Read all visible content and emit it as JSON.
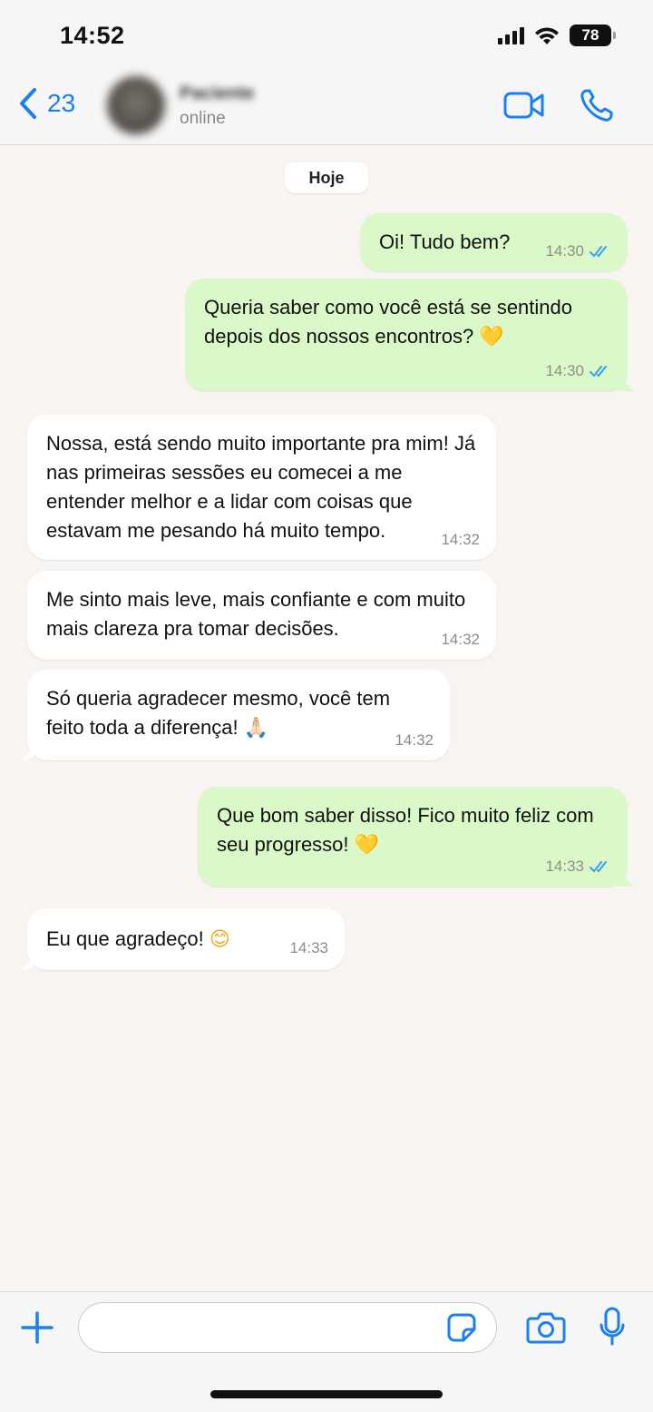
{
  "status_bar": {
    "time": "14:52",
    "battery": "78"
  },
  "header": {
    "back_count": "23",
    "contact_name": "Paciente",
    "contact_status": "online"
  },
  "chat": {
    "date_label": "Hoje",
    "messages": [
      {
        "dir": "out",
        "text": "Oi! Tudo bem?",
        "time": "14:30",
        "read": true
      },
      {
        "dir": "out",
        "text": "Queria saber como você está se sentindo depois dos nossos encontros?",
        "emoji": "💛",
        "time": "14:30",
        "read": true
      },
      {
        "dir": "in",
        "text": "Nossa, está sendo muito importante pra mim! Já nas primeiras sessões eu comecei a me entender melhor e a lidar com coisas que estavam me pesando há muito tempo.",
        "time": "14:32"
      },
      {
        "dir": "in",
        "text": "Me sinto mais leve, mais confiante e com muito mais clareza pra tomar decisões.",
        "time": "14:32"
      },
      {
        "dir": "in",
        "text": "Só queria agradecer mesmo, você tem feito toda a diferença!",
        "emoji": "🙏🏻",
        "time": "14:32"
      },
      {
        "dir": "out",
        "text": "Que bom saber disso! Fico muito feliz com seu progresso!",
        "emoji": "💛",
        "time": "14:33",
        "read": true
      },
      {
        "dir": "in",
        "text": "Eu que agradeço!",
        "emoji": "😊",
        "time": "14:33"
      }
    ]
  },
  "input_bar": {
    "placeholder": ""
  },
  "colors": {
    "accent": "#1a7ff0",
    "outgoing_bubble": "#dbf8c8",
    "incoming_bubble": "#ffffff",
    "read_check": "#34a3f5"
  }
}
